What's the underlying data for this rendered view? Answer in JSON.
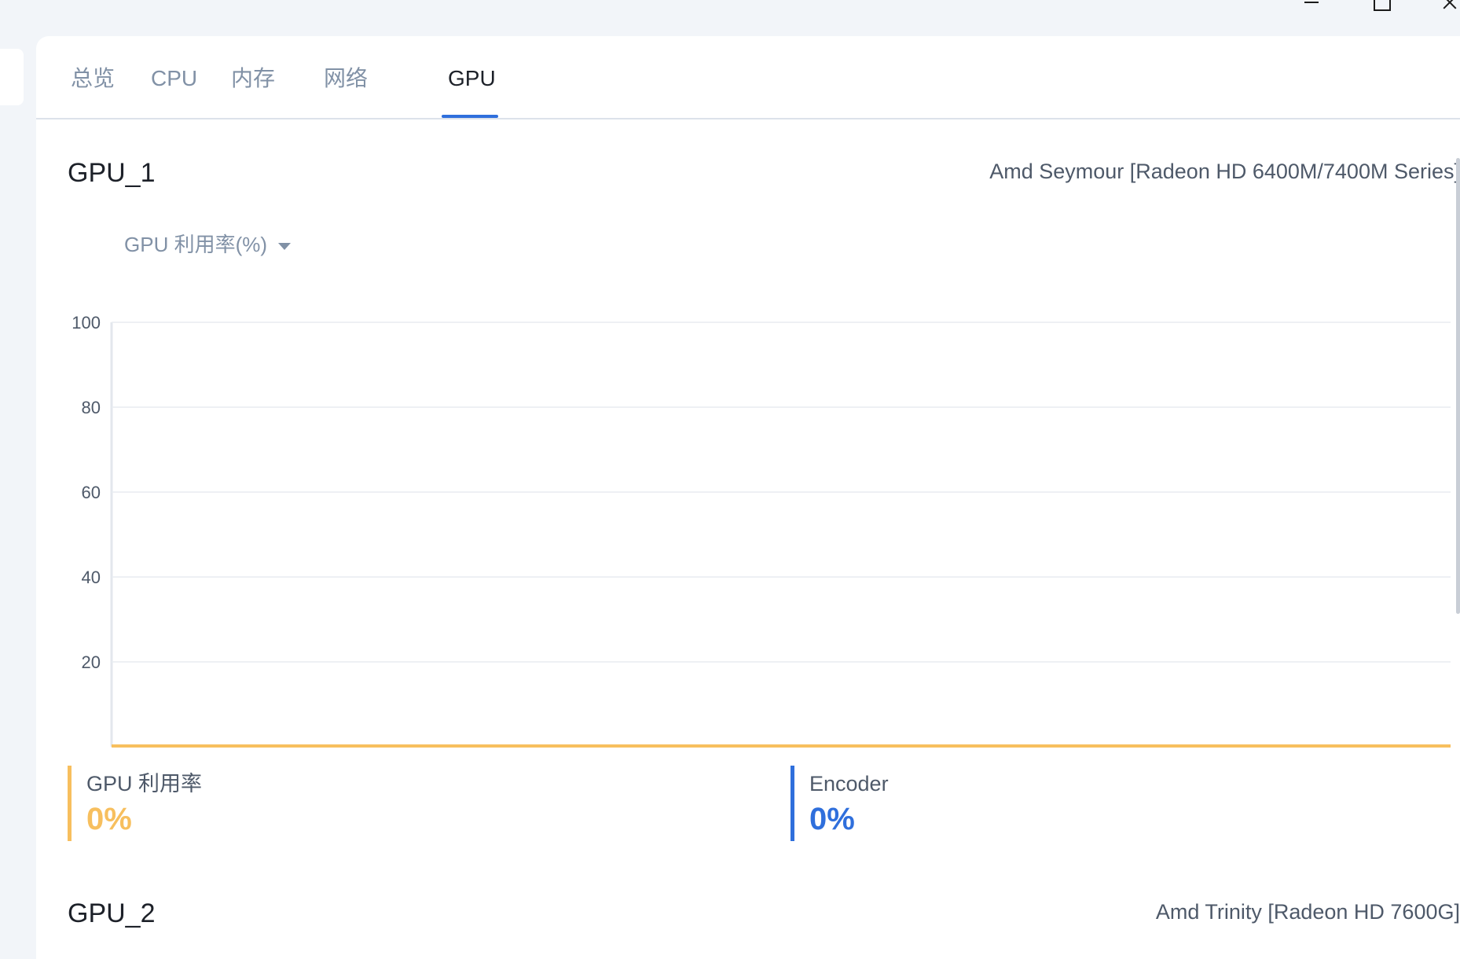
{
  "tabs": [
    {
      "label": "总览"
    },
    {
      "label": "CPU"
    },
    {
      "label": "内存"
    },
    {
      "label": "网络"
    },
    {
      "label": "GPU"
    }
  ],
  "active_tab": "GPU",
  "gpus": [
    {
      "name": "GPU_1",
      "model": "Amd Seymour [Radeon HD 6400M/7400M Series]",
      "metric_select": "GPU 利用率(%)",
      "stats": [
        {
          "label": "GPU 利用率",
          "value": "0%",
          "color": "#f7bf5e"
        },
        {
          "label": "Encoder",
          "value": "0%",
          "color": "#2f6fdc"
        }
      ]
    },
    {
      "name": "GPU_2",
      "model": "Amd Trinity [Radeon HD 7600G]"
    }
  ],
  "chart_data": {
    "type": "line",
    "ylim": [
      0,
      100
    ],
    "yticks": [
      "100",
      "80",
      "60",
      "40",
      "20"
    ],
    "grid": true,
    "series": [
      {
        "color": "#f7bf5e",
        "values": [
          0,
          0
        ]
      }
    ]
  }
}
